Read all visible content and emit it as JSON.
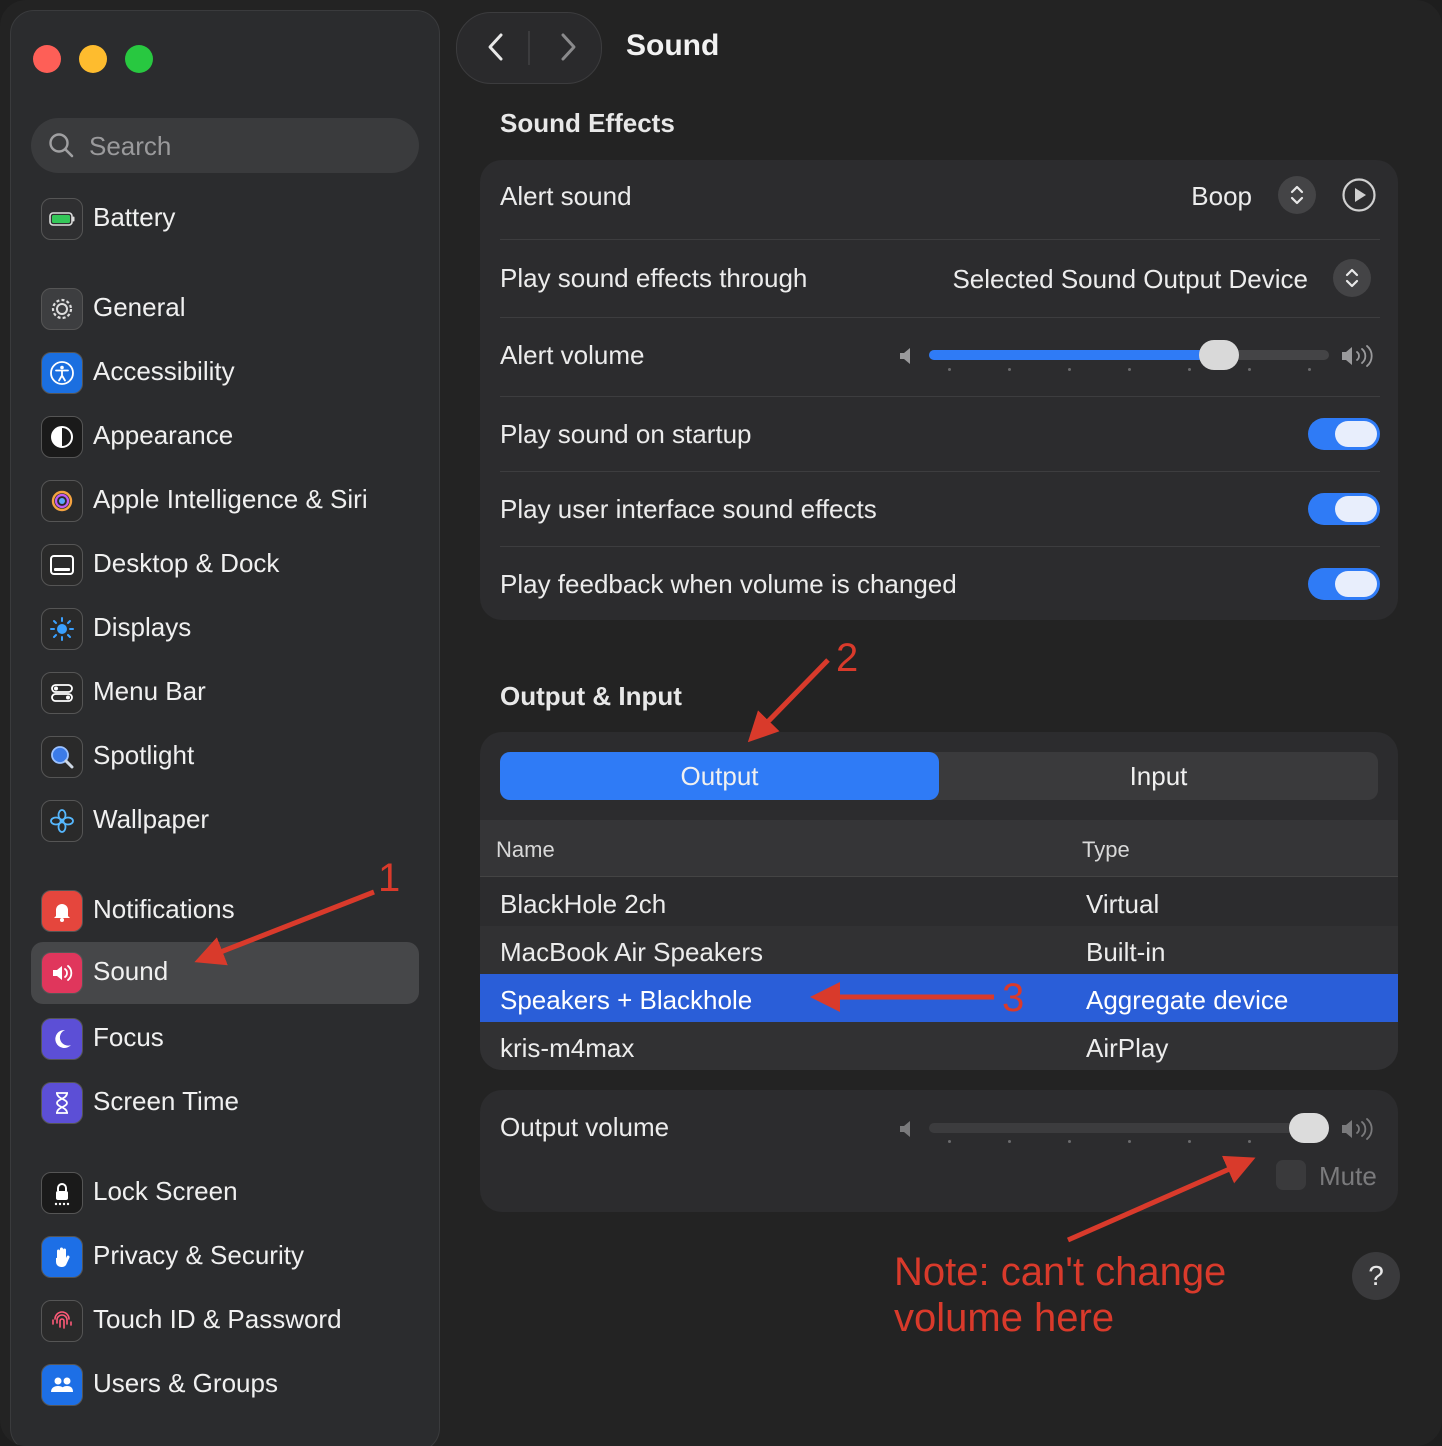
{
  "window": {
    "title": "Sound",
    "colors": {
      "accent": "#2f7bf6",
      "annotation": "#d93a2b"
    }
  },
  "sidebar": {
    "search": {
      "placeholder": "Search"
    },
    "items": [
      {
        "label": "Battery",
        "icon": "battery-icon"
      },
      {
        "label": "General",
        "icon": "gear-icon"
      },
      {
        "label": "Accessibility",
        "icon": "accessibility-icon"
      },
      {
        "label": "Appearance",
        "icon": "appearance-icon"
      },
      {
        "label": "Apple Intelligence & Siri",
        "icon": "siri-icon"
      },
      {
        "label": "Desktop & Dock",
        "icon": "dock-icon"
      },
      {
        "label": "Displays",
        "icon": "sun-icon"
      },
      {
        "label": "Menu Bar",
        "icon": "menu-bar-icon"
      },
      {
        "label": "Spotlight",
        "icon": "magnifier-icon"
      },
      {
        "label": "Wallpaper",
        "icon": "flower-icon"
      },
      {
        "label": "Notifications",
        "icon": "bell-icon"
      },
      {
        "label": "Sound",
        "icon": "speaker-icon",
        "selected": true
      },
      {
        "label": "Focus",
        "icon": "moon-icon"
      },
      {
        "label": "Screen Time",
        "icon": "hourglass-icon"
      },
      {
        "label": "Lock Screen",
        "icon": "lock-icon"
      },
      {
        "label": "Privacy & Security",
        "icon": "hand-icon"
      },
      {
        "label": "Touch ID & Password",
        "icon": "fingerprint-icon"
      },
      {
        "label": "Users & Groups",
        "icon": "users-icon"
      }
    ]
  },
  "sound_effects": {
    "title": "Sound Effects",
    "alert_sound": {
      "label": "Alert sound",
      "value": "Boop"
    },
    "play_through": {
      "label": "Play sound effects through",
      "value": "Selected Sound Output Device"
    },
    "alert_volume": {
      "label": "Alert volume",
      "level": 0.75
    },
    "startup": {
      "label": "Play sound on startup",
      "on": true
    },
    "ui_effects": {
      "label": "Play user interface sound effects",
      "on": true
    },
    "feedback": {
      "label": "Play feedback when volume is changed",
      "on": true
    }
  },
  "output_input": {
    "title": "Output & Input",
    "tabs": {
      "output": "Output",
      "input": "Input",
      "selected": "Output"
    },
    "columns": {
      "name": "Name",
      "type": "Type"
    },
    "devices": [
      {
        "name": "BlackHole 2ch",
        "type": "Virtual"
      },
      {
        "name": "MacBook Air Speakers",
        "type": "Built-in"
      },
      {
        "name": "Speakers + Blackhole",
        "type": "Aggregate device",
        "selected": true
      },
      {
        "name": "kris-m4max",
        "type": "AirPlay"
      }
    ],
    "output_volume": {
      "label": "Output volume",
      "level": 1.0
    },
    "mute": {
      "label": "Mute",
      "checked": false
    }
  },
  "help": {
    "label": "?"
  },
  "annotations": {
    "step1": "1",
    "step2": "2",
    "step3": "3",
    "note_line1": "Note: can't change",
    "note_line2": "volume here"
  }
}
